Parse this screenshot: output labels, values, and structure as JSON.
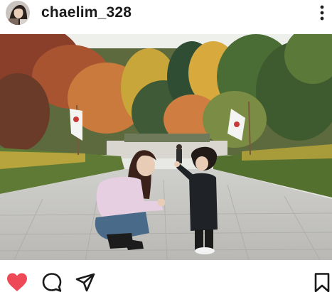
{
  "post": {
    "username": "chaelim_328",
    "avatar_icon": "profile-photo",
    "more_icon": "vertical-ellipsis-icon"
  },
  "actions": {
    "like_icon": "heart-icon",
    "like_active": true,
    "like_color": "#ed4956",
    "comment_icon": "comment-icon",
    "share_icon": "send-icon",
    "save_icon": "bookmark-icon"
  }
}
